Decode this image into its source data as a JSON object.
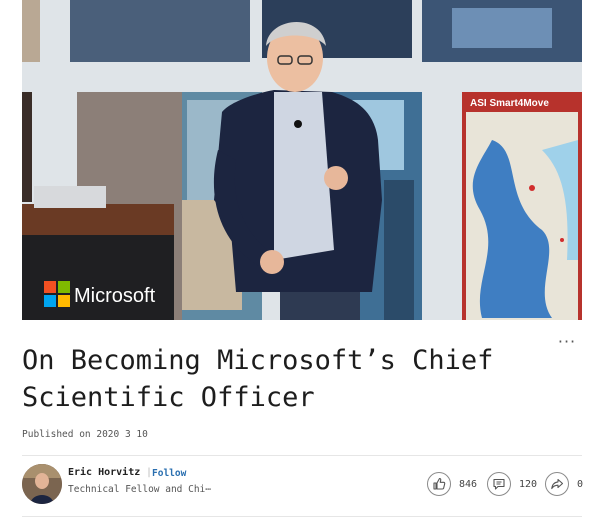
{
  "hero": {
    "logo_text": "Microsoft",
    "screen_label": "ASI Smart4Move"
  },
  "more_menu": {
    "label": "···"
  },
  "article": {
    "title_line1": "On Becoming Microsoft’s Chief",
    "title_line2": "Scientific Officer",
    "published": "Published on 2020 3 10"
  },
  "author": {
    "name": "Eric Horvitz",
    "separator": "|",
    "follow_label": "Follow",
    "headline": "Technical Fellow and Chi⋯"
  },
  "stats": {
    "likes": "846",
    "comments": "120",
    "shares": "0"
  },
  "colors": {
    "follow_link": "#2a6fb0",
    "ms_red": "#f25022",
    "ms_green": "#7fba00",
    "ms_blue": "#00a4ef",
    "ms_yellow": "#ffb900"
  }
}
